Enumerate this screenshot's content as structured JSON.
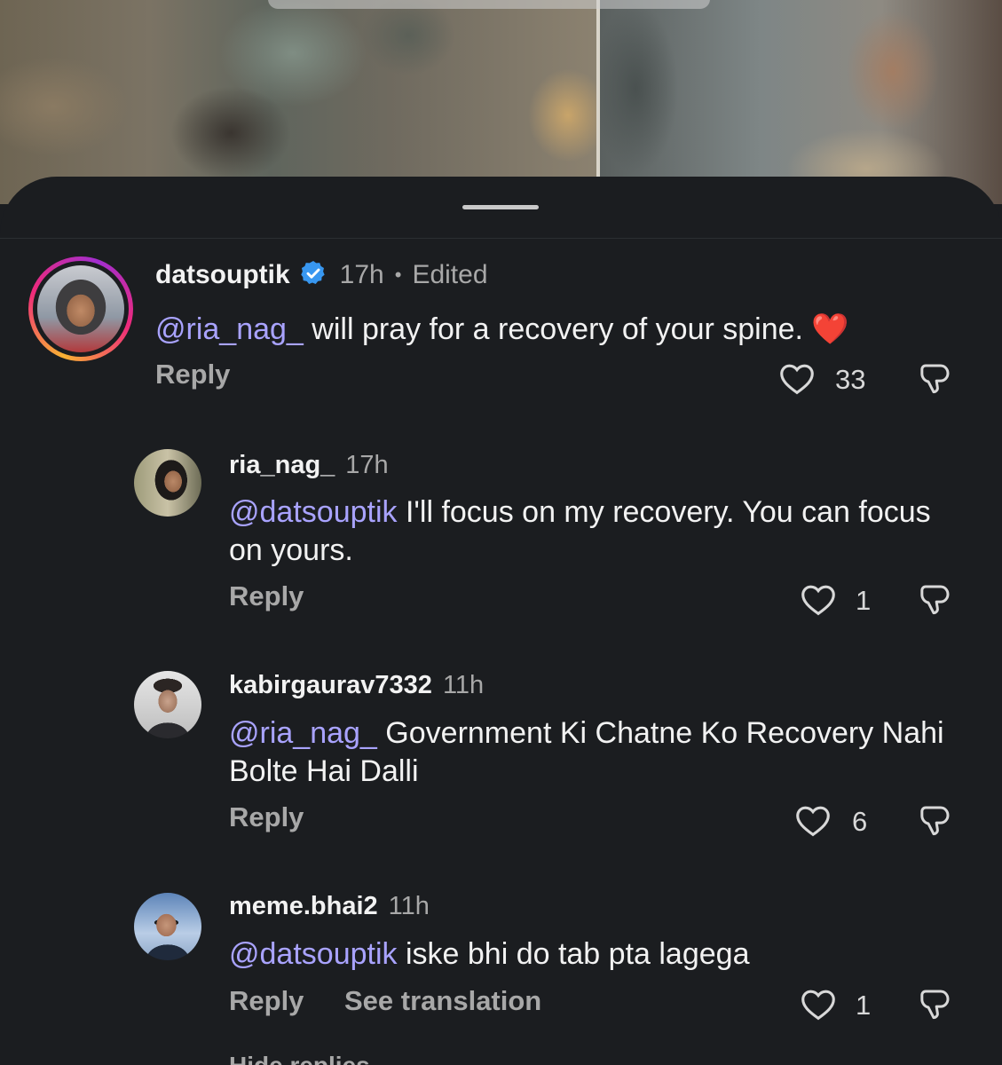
{
  "comments": [
    {
      "username": "datsouptik",
      "verified": true,
      "time": "17h",
      "separator": "•",
      "edited": "Edited",
      "mention": "@ria_nag_",
      "text": " will pray for a recovery of your spine. ",
      "emoji": "❤️",
      "reply_label": "Reply",
      "likes": "33"
    },
    {
      "username": "ria_nag_",
      "time": "17h",
      "mention": "@datsouptik",
      "text": " I'll focus on my recovery. You can focus on yours.",
      "reply_label": "Reply",
      "likes": "1"
    },
    {
      "username": "kabirgaurav7332",
      "time": "11h",
      "mention": "@ria_nag_",
      "text": " Government Ki Chatne Ko Recovery Nahi Bolte Hai Dalli",
      "reply_label": "Reply",
      "likes": "6"
    },
    {
      "username": "meme.bhai2",
      "time": "11h",
      "mention": "@datsouptik",
      "text": " iske bhi do tab pta lagega",
      "reply_label": "Reply",
      "translate_label": "See translation",
      "likes": "1"
    }
  ],
  "footer": {
    "hide_replies": "Hide replies"
  },
  "icons": {
    "verified": "verified-badge-icon",
    "like": "heart-icon",
    "dislike": "thumbs-down-icon"
  },
  "colors": {
    "background": "#1b1d20",
    "mention": "#a9a3ff",
    "verified": "#3897f0",
    "muted": "#a8a8a8"
  }
}
